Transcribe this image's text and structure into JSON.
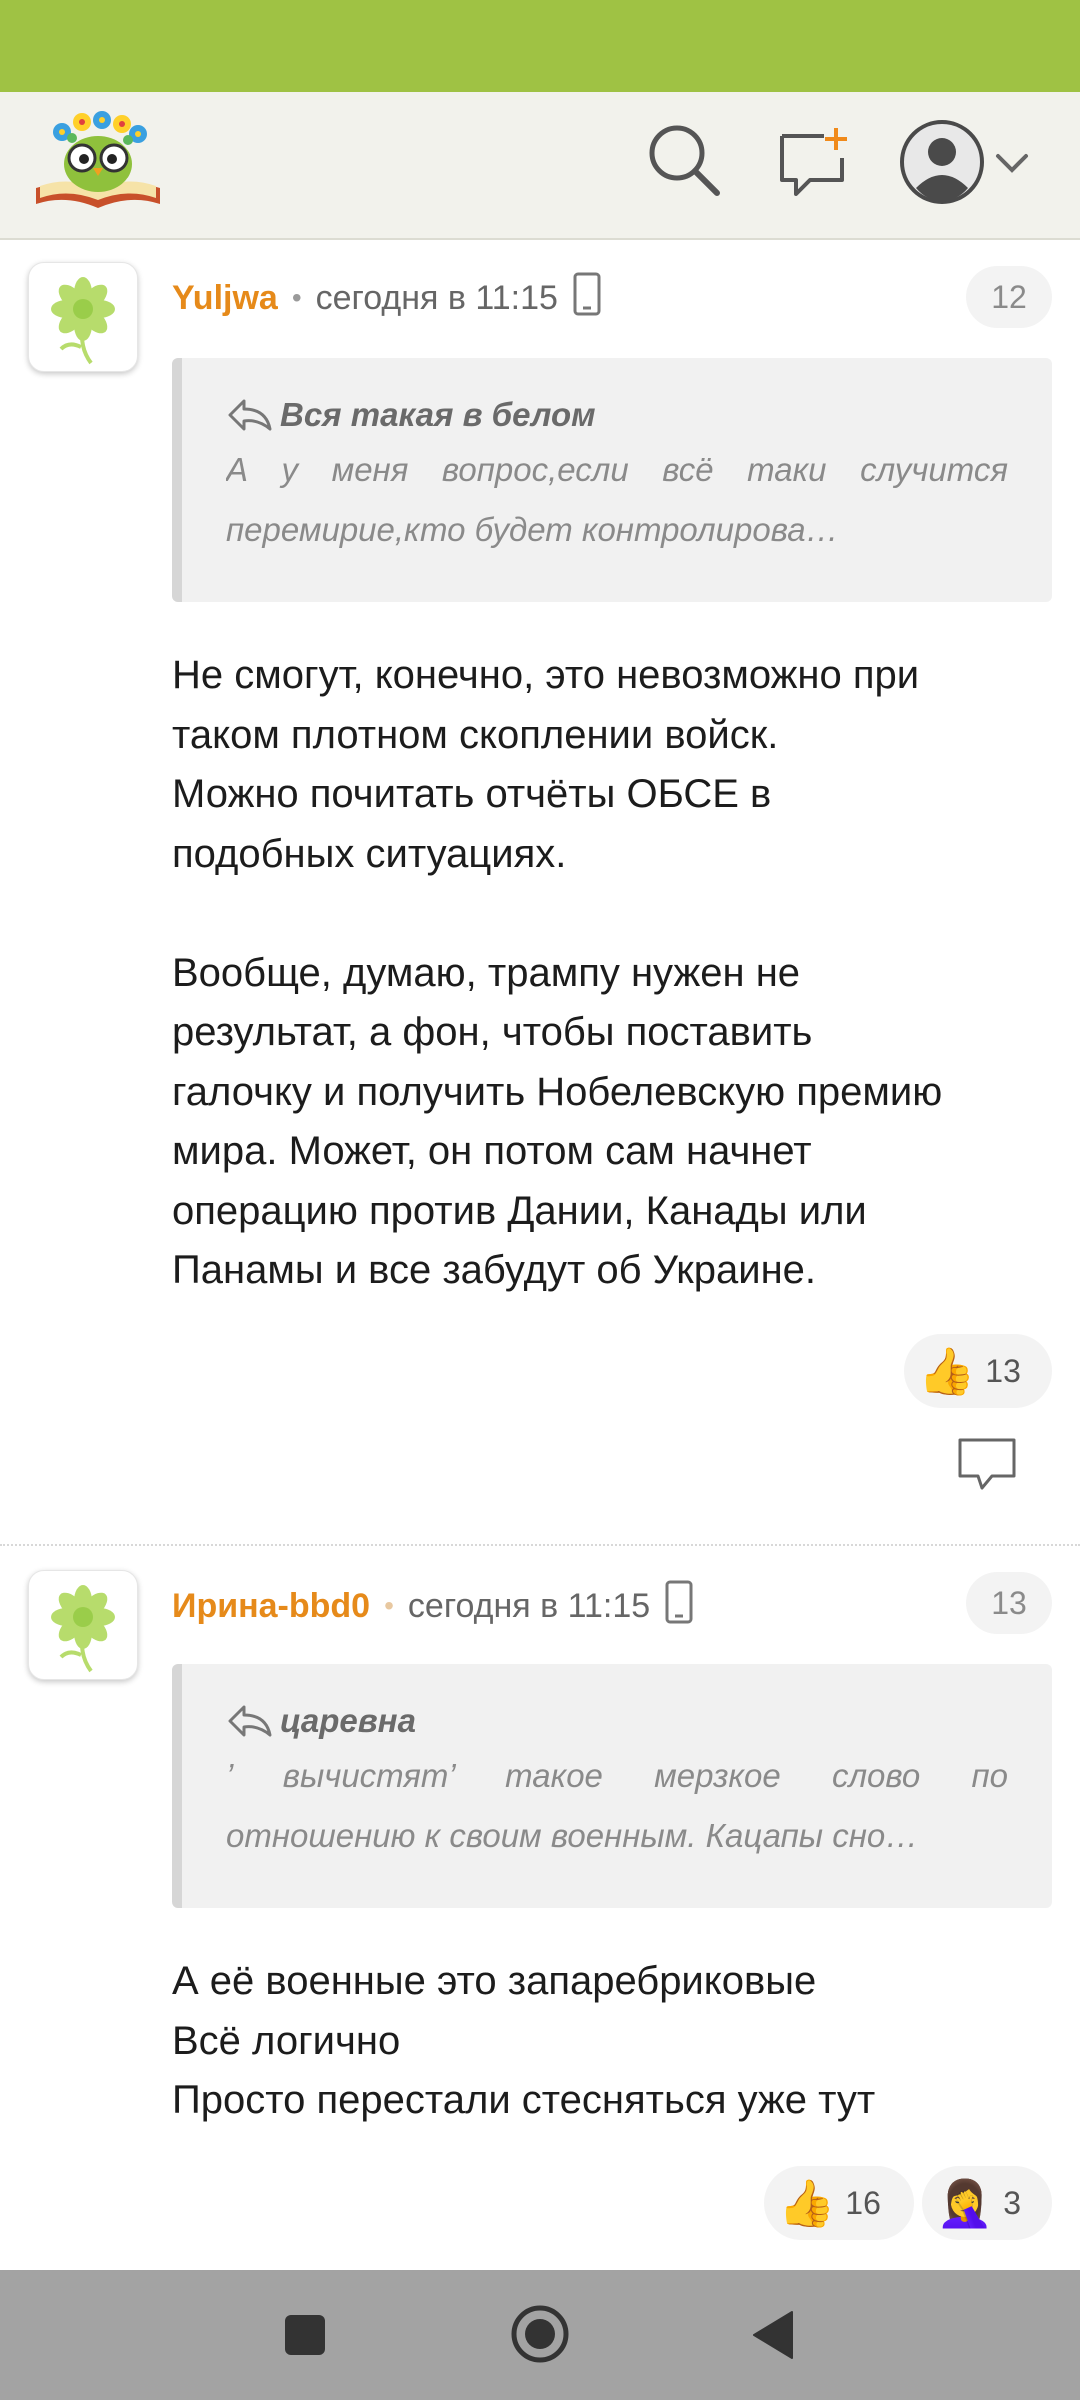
{
  "colors": {
    "status_bar": "#9fc244",
    "author": "#e68a1a",
    "navbar": "#a3a3a3"
  },
  "header": {
    "logo_icon": "book-owl-logo-icon",
    "search_icon": "search-icon",
    "new_post_icon": "new-post-icon",
    "account_icon": "account-icon",
    "dropdown_icon": "chevron-down-icon"
  },
  "comments": [
    {
      "author": "Yuljwa",
      "time": "сегодня в 11:15",
      "number": "12",
      "quote": {
        "author": "Вся такая в белом",
        "lines": [
          "А у меня вопрос,если всё таки случится",
          "перемирие,кто будет контролирова…"
        ]
      },
      "body": [
        "Не смогут, конечно, это невозможно при",
        "таком плотном скоплении войск.",
        "Можно почитать отчёты ОБСЕ в",
        "подобных ситуациях.",
        "",
        "Вообще, думаю, трампу нужен не",
        "результат, а фон, чтобы поставить",
        "галочку и получить Нобелевскую премию",
        "мира. Может, он потом сам начнет",
        "операцию против Дании, Канады или",
        "Панамы и все забудут об Украине."
      ],
      "reactions": [
        {
          "emoji": "👍",
          "count": "13"
        }
      ]
    },
    {
      "author": "Ирина-bbd0",
      "time": "сегодня в 11:15",
      "number": "13",
      "quote": {
        "author": "царевна",
        "lines": [
          "’ вычистят’ такое мерзкое слово по",
          "отношению к своим военным. Кацапы сно…"
        ]
      },
      "body": [
        "А её военные это запаребриковые",
        "Всё логично",
        "Просто перестали стесняться уже тут"
      ],
      "reactions": [
        {
          "emoji": "👍",
          "count": "16"
        },
        {
          "emoji": "🤦‍♀️",
          "count": "3"
        }
      ]
    }
  ]
}
